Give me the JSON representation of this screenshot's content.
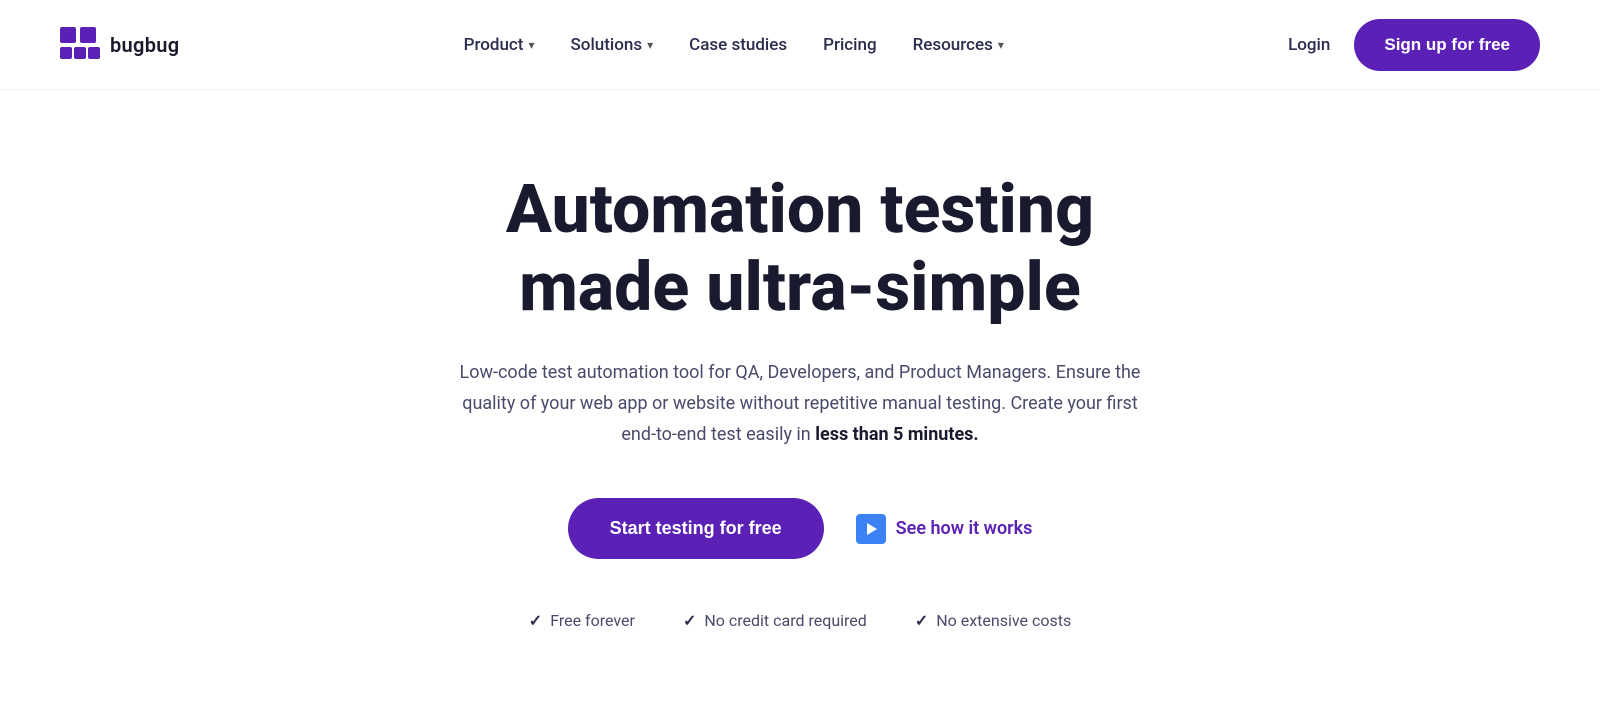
{
  "brand": {
    "logo_text": "bugbug",
    "logo_aria": "BugBug logo"
  },
  "navbar": {
    "links": [
      {
        "label": "Product",
        "has_dropdown": true
      },
      {
        "label": "Solutions",
        "has_dropdown": true
      },
      {
        "label": "Case studies",
        "has_dropdown": false
      },
      {
        "label": "Pricing",
        "has_dropdown": false
      },
      {
        "label": "Resources",
        "has_dropdown": true
      }
    ],
    "login_label": "Login",
    "signup_label": "Sign up for free"
  },
  "hero": {
    "title_line1": "Automation testing",
    "title_line2": "made ultra-simple",
    "subtitle": "Low-code test automation tool for QA, Developers, and Product Managers. Ensure the quality of your web app or website without repetitive manual testing. Create your first end-to-end test easily in ",
    "subtitle_bold": "less than 5 minutes.",
    "cta_primary": "Start testing for free",
    "cta_secondary": "See how it works",
    "features": [
      {
        "label": "Free forever"
      },
      {
        "label": "No credit card required"
      },
      {
        "label": "No extensive costs"
      }
    ]
  },
  "colors": {
    "accent_purple": "#5b21b6",
    "accent_blue": "#3b82f6",
    "text_dark": "#1a1a2e",
    "text_muted": "#4a4a6a"
  }
}
